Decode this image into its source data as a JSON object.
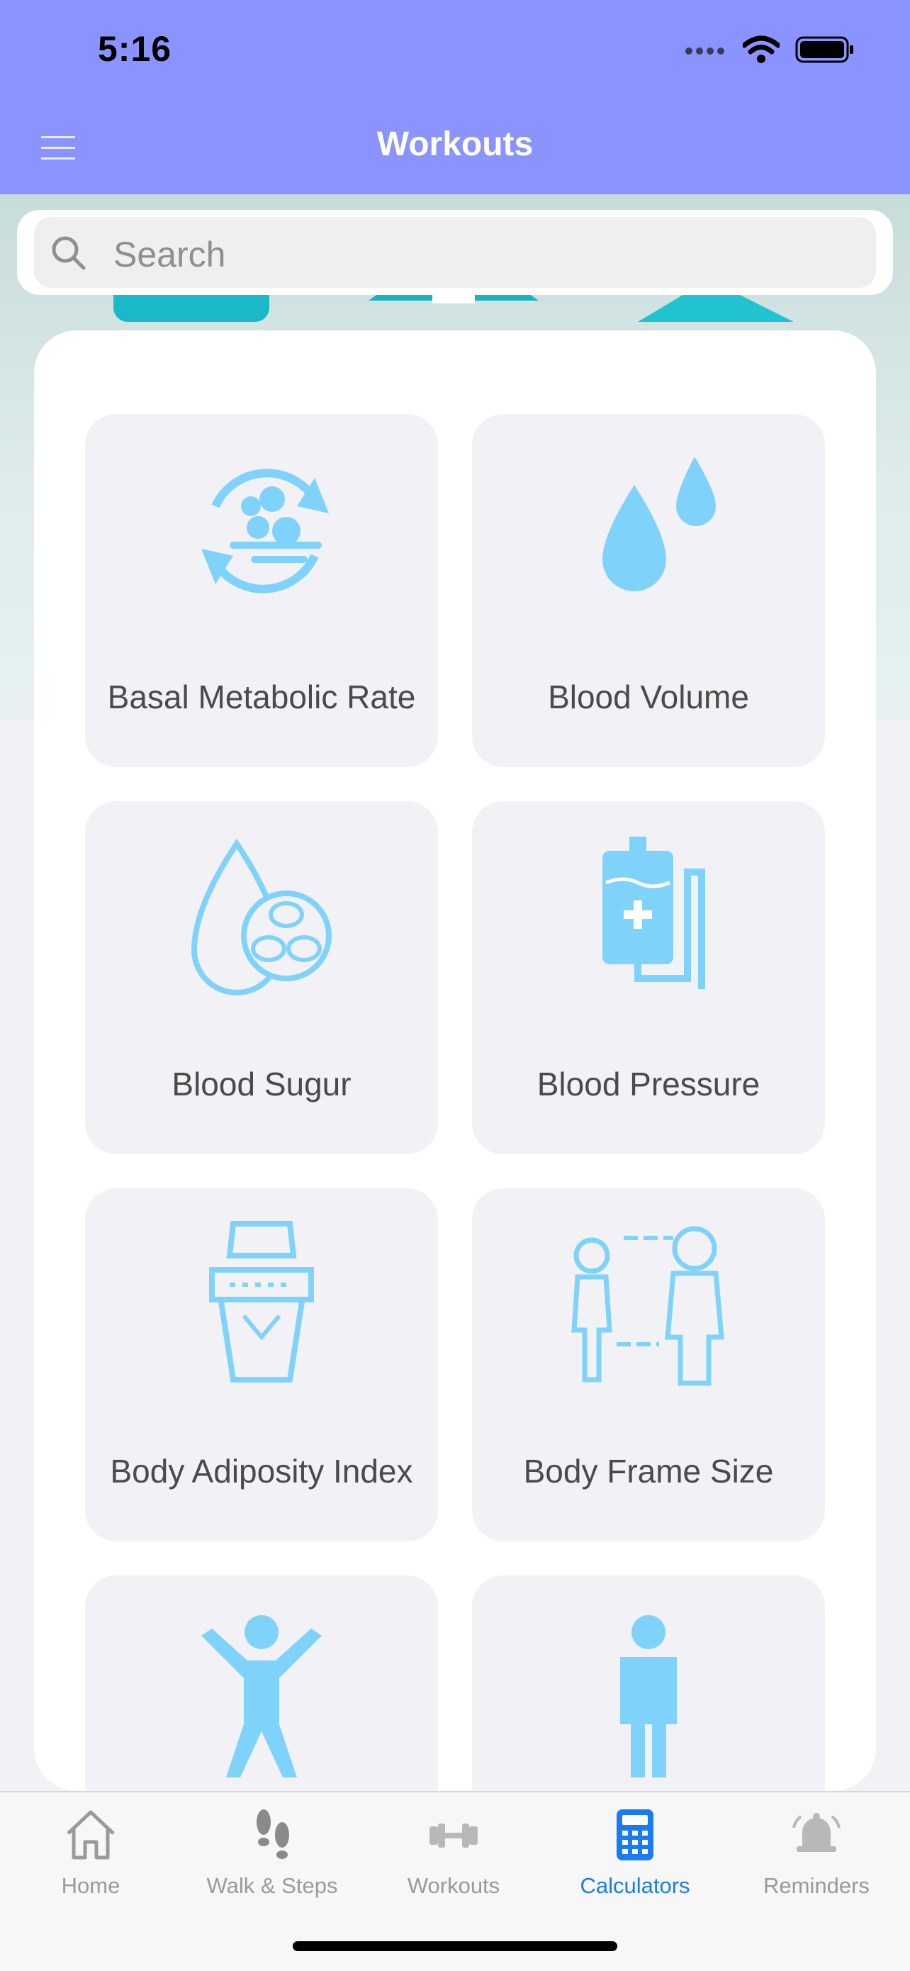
{
  "status_bar": {
    "time": "5:16"
  },
  "nav": {
    "title": "Workouts"
  },
  "search": {
    "placeholder": "Search"
  },
  "calculators": [
    {
      "label": "Basal Metabolic Rate",
      "icon": "metabolism-icon"
    },
    {
      "label": "Blood Volume",
      "icon": "blood-drops-icon"
    },
    {
      "label": "Blood Sugur",
      "icon": "blood-cells-icon"
    },
    {
      "label": "Blood Pressure",
      "icon": "iv-bag-icon"
    },
    {
      "label": "Body Adiposity Index",
      "icon": "waist-icon"
    },
    {
      "label": "Body Frame Size",
      "icon": "body-frame-icon"
    },
    {
      "label": "",
      "icon": "jumping-person-icon"
    },
    {
      "label": "",
      "icon": "standing-person-icon"
    }
  ],
  "tabs": [
    {
      "label": "Home",
      "icon": "home-icon",
      "active": false
    },
    {
      "label": "Walk & Steps",
      "icon": "footsteps-icon",
      "active": false
    },
    {
      "label": "Workouts",
      "icon": "dumbbell-icon",
      "active": false
    },
    {
      "label": "Calculators",
      "icon": "calculator-icon",
      "active": true
    },
    {
      "label": "Reminders",
      "icon": "bell-icon",
      "active": false
    }
  ],
  "colors": {
    "accent": "#8a93ff",
    "icon": "#7fd3fb",
    "active_tab": "#1a7bf2"
  }
}
